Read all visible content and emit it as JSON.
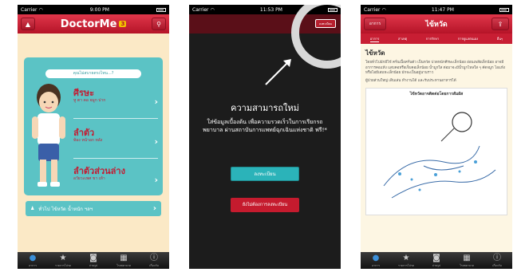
{
  "phone1": {
    "status": {
      "carrier": "Carrier",
      "time": "9:00 PM"
    },
    "header": {
      "logo": "DoctorMe",
      "badge": "3"
    },
    "panel_title": "คุณไม่สบายตรงไหน...?",
    "rows": [
      {
        "title": "ศีรษะ",
        "sub": "หู ตา คอ จมูก ปาก"
      },
      {
        "title": "ลำตัว",
        "sub": "ท้อง หน้าอก หลัง"
      },
      {
        "title": "ลำตัวส่วนล่าง",
        "sub": "อวัยวะเพศ ขา เท้า"
      }
    ],
    "other": "ทั่วไป ไข้หวัด น้ำหนัก ฯลฯ",
    "tabs": [
      "อาการ",
      "รายการโปรด",
      "ถ่ายรูป",
      "โรงพยาบาล",
      "เกี่ยวกับ"
    ]
  },
  "phone2": {
    "status": {
      "carrier": "Carrier",
      "time": "11:53 PM"
    },
    "small_btn": "ลงทะเบียน",
    "title": "ความสามารถใหม่",
    "text": "ใส่ข้อมูลเบื้องต้น เพื่อความรวดเร็วในการเรียกรถพยาบาล ผ่านสถาบันการแพทย์ฉุกเฉินแห่งชาติ ฟรี!*",
    "primary_btn": "ลงทะเบียน",
    "secondary_btn": "ยังไม่ต้องการลงทะเบียน"
  },
  "phone3": {
    "status": {
      "carrier": "Carrier",
      "time": "11:47 PM"
    },
    "back": "อาการ",
    "title": "ไข้หวัด",
    "subtabs": [
      "อาการ",
      "สาเหตุ",
      "การรักษา",
      "การดูแลตนเอง",
      "อื่นๆ"
    ],
    "heading": "ไข้หวัด",
    "para1": "โดยทั่วไปมักมีไข้ ครั่นเนื้อครั่นตัว เป็นหวัด ปวดหนักศีรษะเล็กน้อย อ่อนเพลียเล็กน้อย อาจมีอาการคอแห้ง แสบคอหรือเจ็บคอเล็กน้อย น้ำมูกใส ต่อมาจะมีน้ำมูกไหลใส ๆ คัดจมูก ไอแห้ง หรือไอมีเสมหะเล็กน้อย มักจะเป็นอยู่นานราว",
    "para2": "ผู้ป่วยส่วนใหญ่ เดินเล่น ทำงานได้ และรับประทานอาหารได้",
    "figure_caption": "ไข้หวัดอาจติดต่อโดยการสัมผัส",
    "tabs": [
      "อาการ",
      "รายการโปรด",
      "ถ่ายรูป",
      "โรงพยาบาล",
      "เกี่ยวกับ"
    ]
  }
}
